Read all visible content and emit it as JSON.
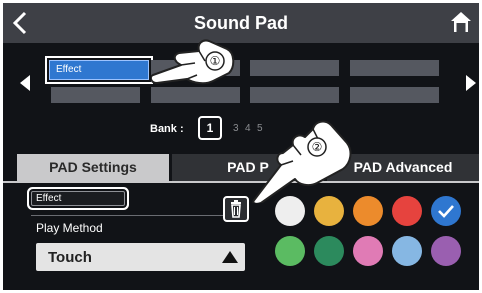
{
  "header": {
    "title": "Sound Pad",
    "back_icon": "chevron-left-icon",
    "home_icon": "home-icon"
  },
  "pads": {
    "selected_label": "Effect",
    "prev_icon": "arrow-left-icon",
    "next_icon": "arrow-right-icon"
  },
  "bank": {
    "label": "Bank :",
    "selected": "1",
    "numbers": [
      "3",
      "4",
      "5"
    ]
  },
  "tabs": [
    {
      "label": "PAD Settings",
      "active": true
    },
    {
      "label": "PAD P",
      "active": false
    },
    {
      "label": "PAD Advanced",
      "active": false
    }
  ],
  "settings": {
    "name_value": "Effect",
    "delete_icon": "trash-icon",
    "play_method_label": "Play Method",
    "play_method_value": "Touch",
    "dropdown_icon": "triangle-up-icon"
  },
  "colors": {
    "row1": [
      "#eeeeee",
      "#e8b23e",
      "#ec8b2c",
      "#e6433e",
      "#2f77d0"
    ],
    "row2": [
      "#5bbb62",
      "#2c8a5d",
      "#e07bb5",
      "#86b7e3",
      "#9a5fb0"
    ],
    "selected_color": "#2f77d0",
    "check_icon": "check-icon"
  },
  "annotations": {
    "callout_1": "①",
    "callout_2": "②",
    "hand_icon": "pointing-hand-icon"
  }
}
